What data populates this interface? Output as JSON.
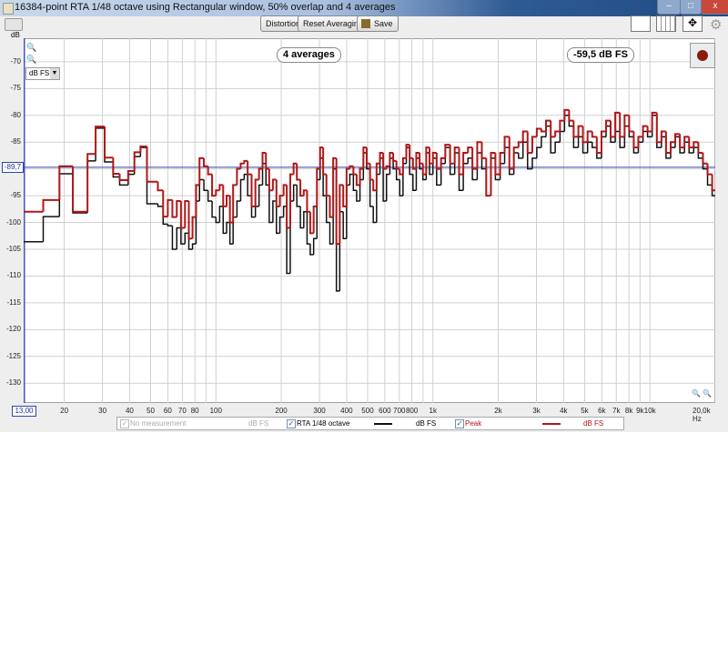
{
  "window": {
    "title": "16384-point RTA 1/48 octave using Rectangular window, 50% overlap and 4 averages",
    "minimize": "–",
    "maximize": "□",
    "close": "x"
  },
  "toolbar": {
    "distortion_label": "Distortion",
    "reset_label": "Reset Averaging",
    "save_label": "Save",
    "icons": [
      "graph-limits-icon",
      "vertical-lines-icon",
      "pan-arrows-icon",
      "gear-icon"
    ]
  },
  "overlay": {
    "averages": "4 averages",
    "level": "-59,5 dB FS",
    "record_color": "#8b1a0a"
  },
  "units_select": {
    "value": "dB FS"
  },
  "cursor": {
    "y_value": "-89,7",
    "y_db": -89.7,
    "x_value": "13,00"
  },
  "legend": {
    "items": [
      {
        "label": "No measurement",
        "unit": "dB FS",
        "checked": true,
        "enabled": false,
        "color": "#c8c8c8"
      },
      {
        "label": "RTA 1/48 octave",
        "unit": "dB FS",
        "checked": true,
        "enabled": true,
        "color": "#111111"
      },
      {
        "label": "Peak",
        "unit": "dB FS",
        "checked": true,
        "enabled": true,
        "color": "#b01818"
      }
    ]
  },
  "chart_data": {
    "type": "line",
    "step": true,
    "xscale": "log",
    "xlim": [
      13,
      20000
    ],
    "ylim": [
      -133.7,
      -65.6
    ],
    "ylabel": "dB",
    "xunit": "Hz",
    "grid": true,
    "yticks": [
      -70,
      -75,
      -80,
      -85,
      -90,
      -95,
      -100,
      -105,
      -110,
      -115,
      -120,
      -125,
      -130
    ],
    "ytick_labels": [
      "-70",
      "-75",
      "-80",
      "-85",
      "-90",
      "-95",
      "-100",
      "-105",
      "-110",
      "-115",
      "-120",
      "-125",
      "-130"
    ],
    "xticks": [
      20,
      30,
      40,
      50,
      60,
      70,
      80,
      100,
      200,
      300,
      400,
      500,
      600,
      700,
      800,
      1000,
      2000,
      3000,
      4000,
      5000,
      6000,
      7000,
      8000,
      9000,
      10000,
      20000
    ],
    "xtick_labels": [
      "20",
      "30",
      "40",
      "50",
      "60",
      "70",
      "80",
      "100",
      "200",
      "300",
      "400",
      "500",
      "600",
      "700",
      "800",
      "1k",
      "2k",
      "3k",
      "4k",
      "5k",
      "6k",
      "7k",
      "8k",
      "9k",
      "10k",
      "20,0k Hz"
    ],
    "minor_xticks": [
      90,
      900
    ],
    "cursor_line_db": -89.7,
    "freq": [
      13,
      16,
      19,
      21.9,
      25.6,
      27.9,
      30.7,
      33.6,
      36,
      39.4,
      42.1,
      44.9,
      48.1,
      54,
      57.1,
      60,
      63,
      66,
      69,
      72,
      75,
      78,
      81,
      84,
      88,
      92,
      96,
      100,
      104,
      108,
      112,
      116,
      120,
      125,
      130,
      135,
      140,
      146,
      152,
      158,
      164,
      170,
      176,
      183,
      190,
      197,
      205,
      212,
      220,
      228,
      236,
      245,
      254,
      263,
      272,
      282,
      292,
      302,
      312,
      323,
      335,
      347,
      359,
      372,
      386,
      400,
      414,
      430,
      445,
      461,
      478,
      495,
      513,
      531,
      550,
      570,
      590,
      611,
      633,
      656,
      679,
      703,
      728,
      754,
      781,
      809,
      838,
      868,
      899,
      931,
      964,
      1000,
      1040,
      1090,
      1140,
      1200,
      1260,
      1320,
      1380,
      1450,
      1520,
      1600,
      1680,
      1760,
      1850,
      1940,
      2040,
      2140,
      2250,
      2360,
      2480,
      2600,
      2730,
      2870,
      3010,
      3160,
      3320,
      3490,
      3660,
      3850,
      4040,
      4240,
      4450,
      4680,
      4910,
      5160,
      5420,
      5690,
      5980,
      6280,
      6590,
      6920,
      7270,
      7640,
      8020,
      8420,
      8840,
      9290,
      9750,
      10240,
      10760,
      11300,
      11860,
      12460,
      13080,
      13740,
      14430,
      15150,
      15910,
      16710,
      17550,
      18430,
      19350
    ],
    "series": [
      {
        "name": "RTA 1/48 octave",
        "color": "#111111",
        "values": [
          -103.6,
          -98.9,
          -90.9,
          -98.2,
          -88.5,
          -82.4,
          -88.7,
          -91.5,
          -93,
          -91,
          -87.7,
          -86,
          -96.5,
          -97,
          -100.3,
          -100.6,
          -105,
          -101,
          -104,
          -102,
          -105,
          -104,
          -96,
          -92,
          -94,
          -96,
          -99,
          -100,
          -97,
          -102,
          -100,
          -104,
          -99,
          -96,
          -92,
          -91,
          -95,
          -99,
          -97,
          -93,
          -89,
          -93,
          -100,
          -96,
          -102,
          -99,
          -97,
          -109.5,
          -96,
          -93,
          -97,
          -101,
          -98,
          -104,
          -106,
          -103,
          -92,
          -88,
          -95,
          -100,
          -104,
          -90,
          -112.8,
          -98,
          -103,
          -93,
          -91,
          -94,
          -96,
          -92,
          -87,
          -90,
          -97,
          -100,
          -91,
          -88,
          -96,
          -91,
          -88,
          -90,
          -92,
          -95,
          -89,
          -86,
          -91,
          -94,
          -88,
          -90,
          -92,
          -87,
          -91,
          -88,
          -93,
          -89,
          -86,
          -91,
          -87,
          -94,
          -89,
          -88,
          -92,
          -87,
          -90,
          -95,
          -88,
          -92,
          -89,
          -86,
          -91,
          -87,
          -88,
          -85,
          -90,
          -88,
          -86,
          -84,
          -82,
          -87,
          -85,
          -83,
          -80,
          -82,
          -86,
          -84,
          -87,
          -85,
          -86,
          -88,
          -84,
          -82,
          -85,
          -83,
          -86,
          -82,
          -84,
          -87,
          -85,
          -83,
          -84,
          -80,
          -86,
          -84,
          -88,
          -86,
          -84,
          -87,
          -85,
          -87,
          -86,
          -88,
          -90,
          -93,
          -95
        ]
      },
      {
        "name": "Peak",
        "color": "#b01818",
        "values": [
          -98,
          -95.8,
          -89.5,
          -98,
          -87.2,
          -82.1,
          -87.9,
          -90.9,
          -92.1,
          -90.4,
          -86.9,
          -85.8,
          -92.4,
          -94,
          -98.9,
          -95.8,
          -99,
          -96,
          -101,
          -96,
          -103,
          -99,
          -93,
          -88,
          -89.5,
          -91,
          -95,
          -94,
          -93,
          -97,
          -95,
          -100,
          -93,
          -90,
          -89,
          -88.5,
          -91,
          -97,
          -92,
          -90,
          -87,
          -90,
          -94,
          -92,
          -97,
          -95,
          -93,
          -101,
          -91,
          -89,
          -92,
          -95,
          -94,
          -98,
          -102,
          -97,
          -90,
          -86,
          -91,
          -95,
          -99,
          -88,
          -104,
          -93,
          -97,
          -90,
          -89.5,
          -91,
          -93,
          -90,
          -86,
          -89,
          -92,
          -94,
          -89,
          -87,
          -90,
          -89.5,
          -87,
          -88.5,
          -90,
          -91,
          -88,
          -85.5,
          -88,
          -90,
          -87,
          -89,
          -91,
          -86,
          -89,
          -87,
          -90,
          -88,
          -85.5,
          -89,
          -86,
          -91,
          -87,
          -86,
          -90,
          -85,
          -88,
          -95,
          -87,
          -91,
          -87,
          -84,
          -90,
          -86,
          -85,
          -83,
          -87,
          -84,
          -82.5,
          -83,
          -81,
          -84,
          -83,
          -81,
          -79,
          -81,
          -84,
          -82,
          -85,
          -83,
          -84,
          -87,
          -83,
          -81,
          -84,
          -79.5,
          -84,
          -80,
          -83,
          -86,
          -84,
          -82,
          -83,
          -79.5,
          -85,
          -83,
          -87,
          -85,
          -83.5,
          -86,
          -84,
          -86,
          -85,
          -87,
          -89,
          -91,
          -94
        ]
      }
    ]
  }
}
